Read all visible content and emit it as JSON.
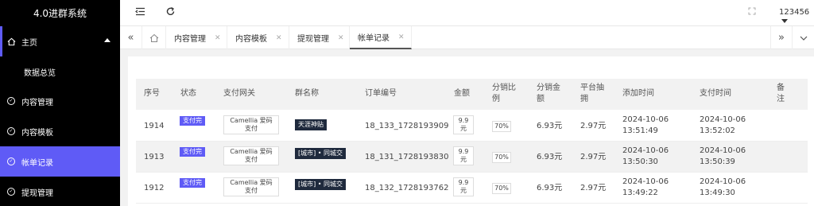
{
  "app_title": "4.0进群系统",
  "sidebar": {
    "parent_label": "主页",
    "items": [
      {
        "label": "数据总览",
        "icon": "none"
      },
      {
        "label": "内容管理",
        "icon": "check-circle-icon"
      },
      {
        "label": "内容模板",
        "icon": "check-circle-icon"
      },
      {
        "label": "帐单记录",
        "icon": "check-circle-icon"
      },
      {
        "label": "提现管理",
        "icon": "check-circle-icon"
      }
    ]
  },
  "header": {
    "username": "123456"
  },
  "tabs": [
    {
      "label": "内容管理"
    },
    {
      "label": "内容模板"
    },
    {
      "label": "提现管理"
    },
    {
      "label": "帐单记录"
    }
  ],
  "colors": {
    "accent": "#5f5bf6",
    "sidebar_bg": "#000000",
    "group_badge": "#1f2a3d"
  },
  "table": {
    "headers": {
      "id": "序号",
      "status": "状态",
      "gateway": "支付网关",
      "group": "群名称",
      "order": "订单编号",
      "amount": "金额",
      "ratio_1": "分销比",
      "ratio_2": "例",
      "dist_amt_1": "分销金",
      "dist_amt_2": "额",
      "commission_1": "平台抽",
      "commission_2": "拥",
      "created": "添加时间",
      "paid": "支付时间",
      "remark_1": "备",
      "remark_2": "注"
    },
    "rows": [
      {
        "id": "1914",
        "status": "支付完",
        "gateway_1": "Camellia 爱码",
        "gateway_2": "支付",
        "group": "天涯神贴",
        "order": "18_133_1728193909",
        "amount_1": "9.9",
        "amount_2": "元",
        "ratio": "70%",
        "dist_amt": "6.93元",
        "commission": "2.97元",
        "created_date": "2024-10-06",
        "created_time": "13:51:49",
        "paid_date": "2024-10-06",
        "paid_time": "13:52:02"
      },
      {
        "id": "1913",
        "status": "支付完",
        "gateway_1": "Camellia 爱码",
        "gateway_2": "支付",
        "group": "[城市] • 同城交",
        "order": "18_131_1728193830",
        "amount_1": "9.9",
        "amount_2": "元",
        "ratio": "70%",
        "dist_amt": "6.93元",
        "commission": "2.97元",
        "created_date": "2024-10-06",
        "created_time": "13:50:30",
        "paid_date": "2024-10-06",
        "paid_time": "13:50:39"
      },
      {
        "id": "1912",
        "status": "支付完",
        "gateway_1": "Camellia 爱码",
        "gateway_2": "支付",
        "group": "[城市] • 同城交",
        "order": "18_132_1728193762",
        "amount_1": "9.9",
        "amount_2": "元",
        "ratio": "70%",
        "dist_amt": "6.93元",
        "commission": "2.97元",
        "created_date": "2024-10-06",
        "created_time": "13:49:22",
        "paid_date": "2024-10-06",
        "paid_time": "13:49:30"
      }
    ]
  }
}
